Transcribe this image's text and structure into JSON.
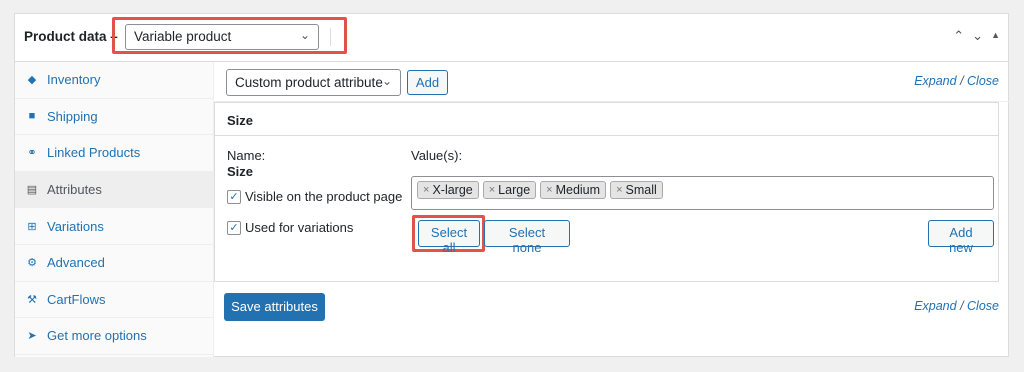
{
  "header": {
    "title": "Product data –",
    "product_type": "Variable product"
  },
  "sidebar": {
    "items": [
      {
        "label": "Inventory",
        "icon": "tag-icon"
      },
      {
        "label": "Shipping",
        "icon": "truck-icon"
      },
      {
        "label": "Linked Products",
        "icon": "link-icon"
      },
      {
        "label": "Attributes",
        "icon": "list-icon"
      },
      {
        "label": "Variations",
        "icon": "grid-icon"
      },
      {
        "label": "Advanced",
        "icon": "gear-icon"
      },
      {
        "label": "CartFlows",
        "icon": "wrench-icon"
      },
      {
        "label": "Get more options",
        "icon": "plug-icon"
      }
    ],
    "active": "Attributes"
  },
  "toolbar": {
    "attribute_select": "Custom product attribute",
    "add_label": "Add",
    "expand": "Expand",
    "close": "Close"
  },
  "attribute": {
    "title": "Size",
    "name_label": "Name:",
    "name_value": "Size",
    "values_label": "Value(s):",
    "values": [
      "X-large",
      "Large",
      "Medium",
      "Small"
    ],
    "visible_label": "Visible on the product page",
    "variations_label": "Used for variations",
    "select_all": "Select all",
    "select_none": "Select none",
    "add_new": "Add new"
  },
  "footer": {
    "save_label": "Save attributes",
    "expand": "Expand",
    "close": "Close"
  },
  "colors": {
    "accent": "#2271b1",
    "highlight": "#e0534a"
  }
}
